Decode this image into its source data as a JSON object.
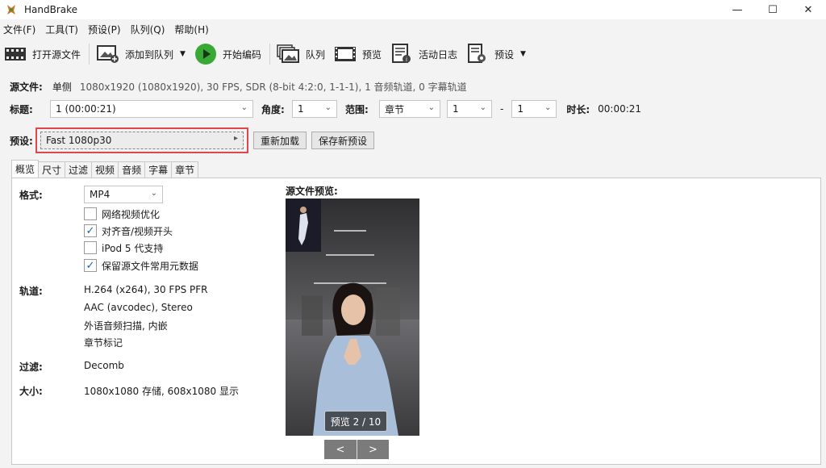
{
  "window": {
    "title": "HandBrake",
    "minimize": "—",
    "maximize": "☐",
    "close": "✕"
  },
  "menu": [
    "文件(F)",
    "工具(T)",
    "预设(P)",
    "队列(Q)",
    "帮助(H)"
  ],
  "toolbar": {
    "open_source": "打开源文件",
    "add_to_queue": "添加到队列",
    "start_encode": "开始编码",
    "queue": "队列",
    "preview": "预览",
    "activity_log": "活动日志",
    "presets": "预设"
  },
  "source": {
    "label": "源文件:",
    "name": "单侧",
    "info": "1080x1920 (1080x1920), 30 FPS, SDR (8-bit 4:2:0, 1-1-1), 1 音频轨道, 0 字幕轨道"
  },
  "title_row": {
    "title_label": "标题:",
    "title_value": "1 (00:00:21)",
    "angle_label": "角度:",
    "angle_value": "1",
    "range_label": "范围:",
    "range_type": "章节",
    "range_start": "1",
    "range_dash": "-",
    "range_end": "1",
    "duration_label": "时长:",
    "duration_value": "00:00:21"
  },
  "preset_row": {
    "label": "预设:",
    "value": "Fast 1080p30",
    "reload": "重新加载",
    "save_new": "保存新预设",
    "highlight_color": "#e0474c"
  },
  "tabs": [
    "概览",
    "尺寸",
    "过滤",
    "视频",
    "音频",
    "字幕",
    "章节"
  ],
  "summary": {
    "format_label": "格式:",
    "format_value": "MP4",
    "options": [
      {
        "label": "网络视频优化",
        "checked": false
      },
      {
        "label": "对齐音/视频开头",
        "checked": true
      },
      {
        "label": "iPod 5 代支持",
        "checked": false
      },
      {
        "label": "保留源文件常用元数据",
        "checked": true
      }
    ],
    "tracks_label": "轨道:",
    "tracks": [
      "H.264 (x264), 30 FPS PFR",
      "AAC (avcodec), Stereo",
      "外语音频扫描, 内嵌",
      "章节标记"
    ],
    "filters_label": "过滤:",
    "filters_value": "Decomb",
    "size_label": "大小:",
    "size_value": "1080x1080 存储, 608x1080 显示"
  },
  "preview": {
    "title": "源文件预览:",
    "counter": "预览 2 / 10",
    "prev": "<",
    "next": ">"
  }
}
